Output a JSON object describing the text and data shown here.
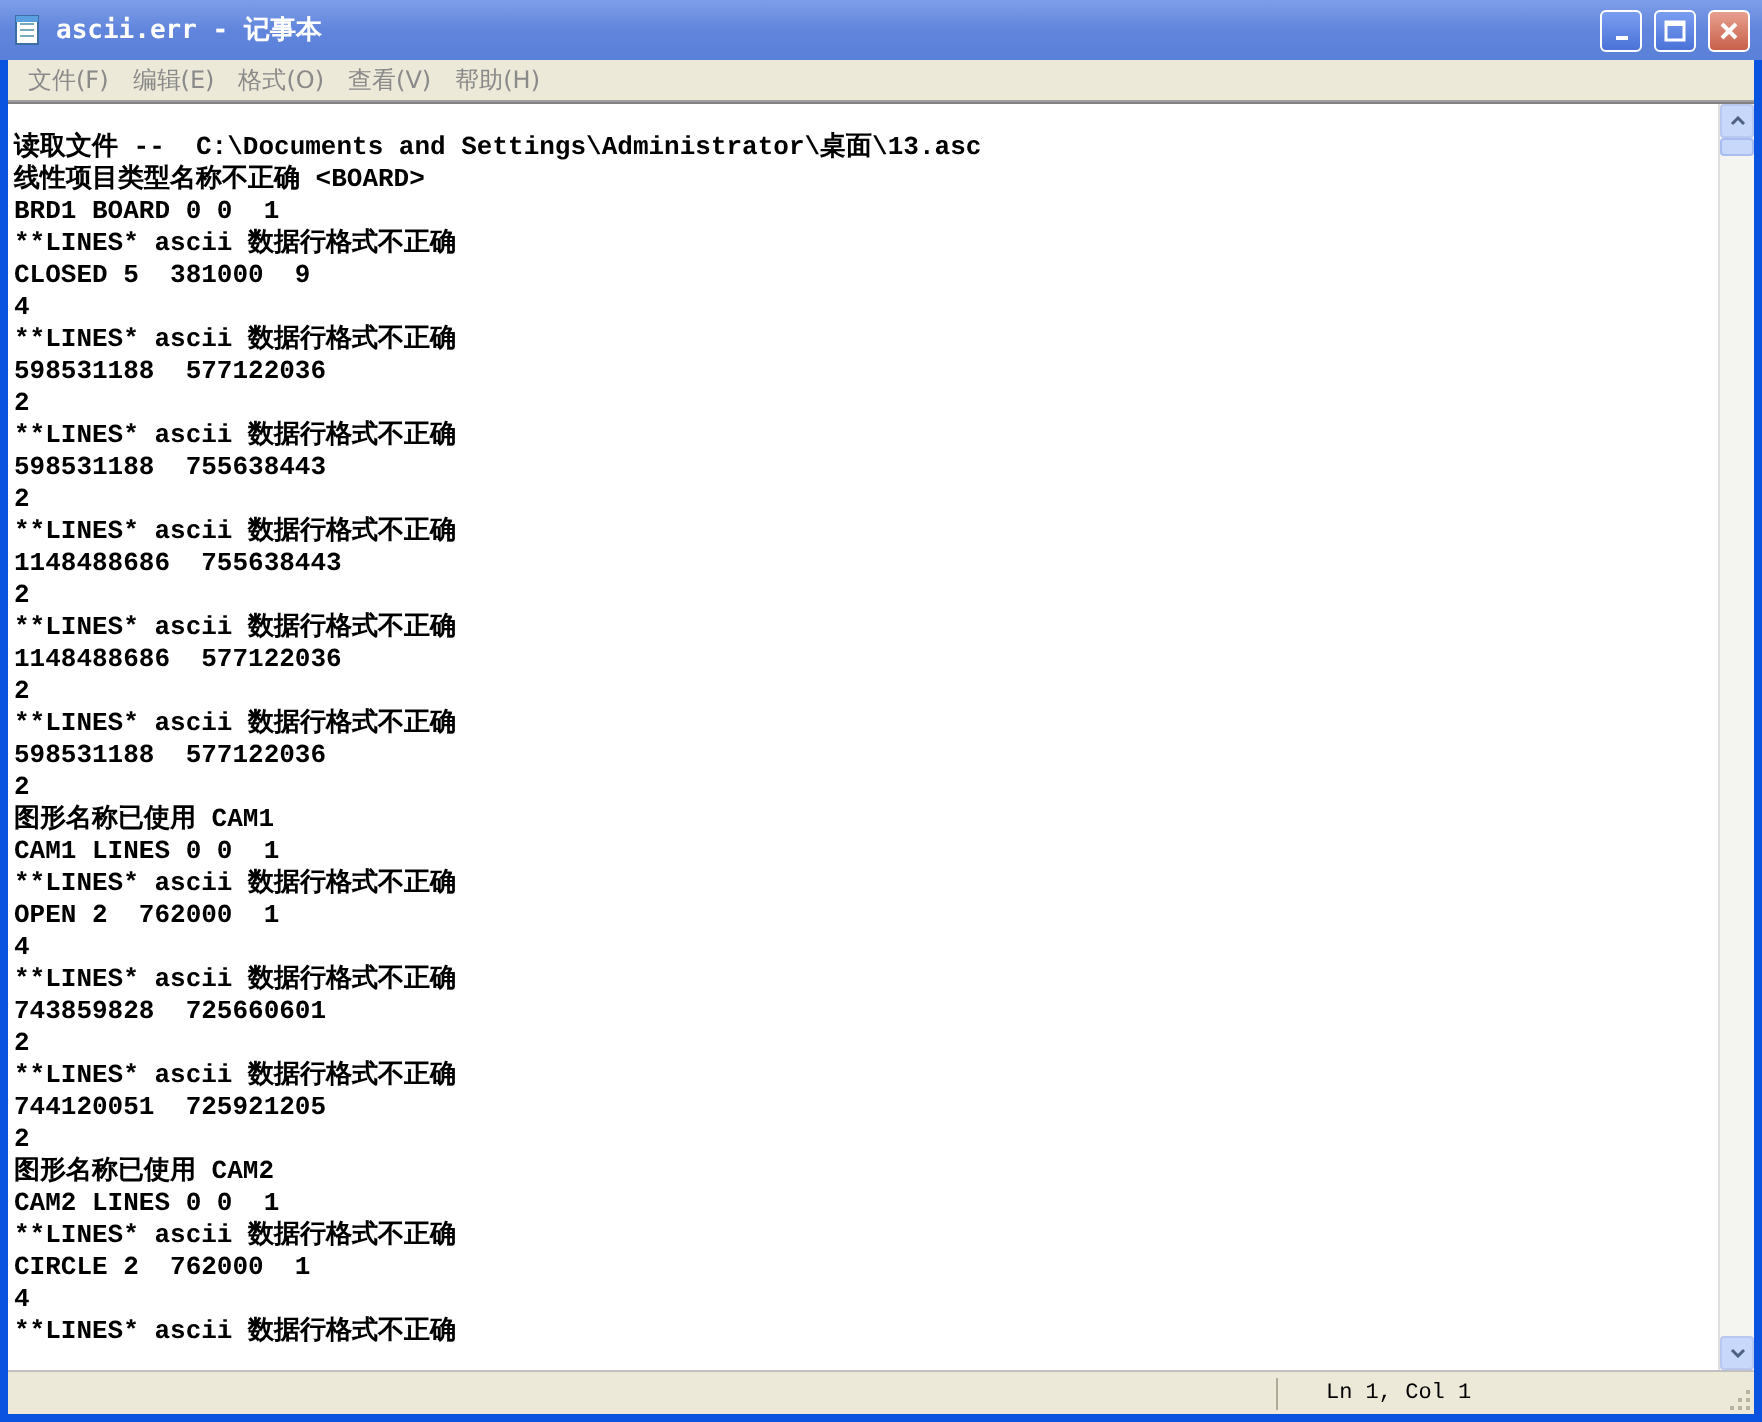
{
  "window": {
    "title": "ascii.err - 记事本"
  },
  "menu": [
    {
      "label": "文件(F)"
    },
    {
      "label": "编辑(E)"
    },
    {
      "label": "格式(O)"
    },
    {
      "label": "查看(V)"
    },
    {
      "label": "帮助(H)"
    }
  ],
  "document": {
    "lines": [
      "读取文件 --  C:\\Documents and Settings\\Administrator\\桌面\\13.asc",
      "线性项目类型名称不正确 <BOARD>",
      "BRD1 BOARD 0 0  1",
      "**LINES* ascii 数据行格式不正确",
      "CLOSED 5  381000  9",
      "4",
      "**LINES* ascii 数据行格式不正确",
      "598531188  577122036",
      "2",
      "**LINES* ascii 数据行格式不正确",
      "598531188  755638443",
      "2",
      "**LINES* ascii 数据行格式不正确",
      "1148488686  755638443",
      "2",
      "**LINES* ascii 数据行格式不正确",
      "1148488686  577122036",
      "2",
      "**LINES* ascii 数据行格式不正确",
      "598531188  577122036",
      "2",
      "图形名称已使用 CAM1",
      "CAM1 LINES 0 0  1",
      "**LINES* ascii 数据行格式不正确",
      "OPEN 2  762000  1",
      "4",
      "**LINES* ascii 数据行格式不正确",
      "743859828  725660601",
      "2",
      "**LINES* ascii 数据行格式不正确",
      "744120051  725921205",
      "2",
      "图形名称已使用 CAM2",
      "CAM2 LINES 0 0  1",
      "**LINES* ascii 数据行格式不正确",
      "CIRCLE 2  762000  1",
      "4",
      "**LINES* ascii 数据行格式不正确"
    ]
  },
  "status_bar": {
    "position": "Ln 1, Col 1"
  }
}
